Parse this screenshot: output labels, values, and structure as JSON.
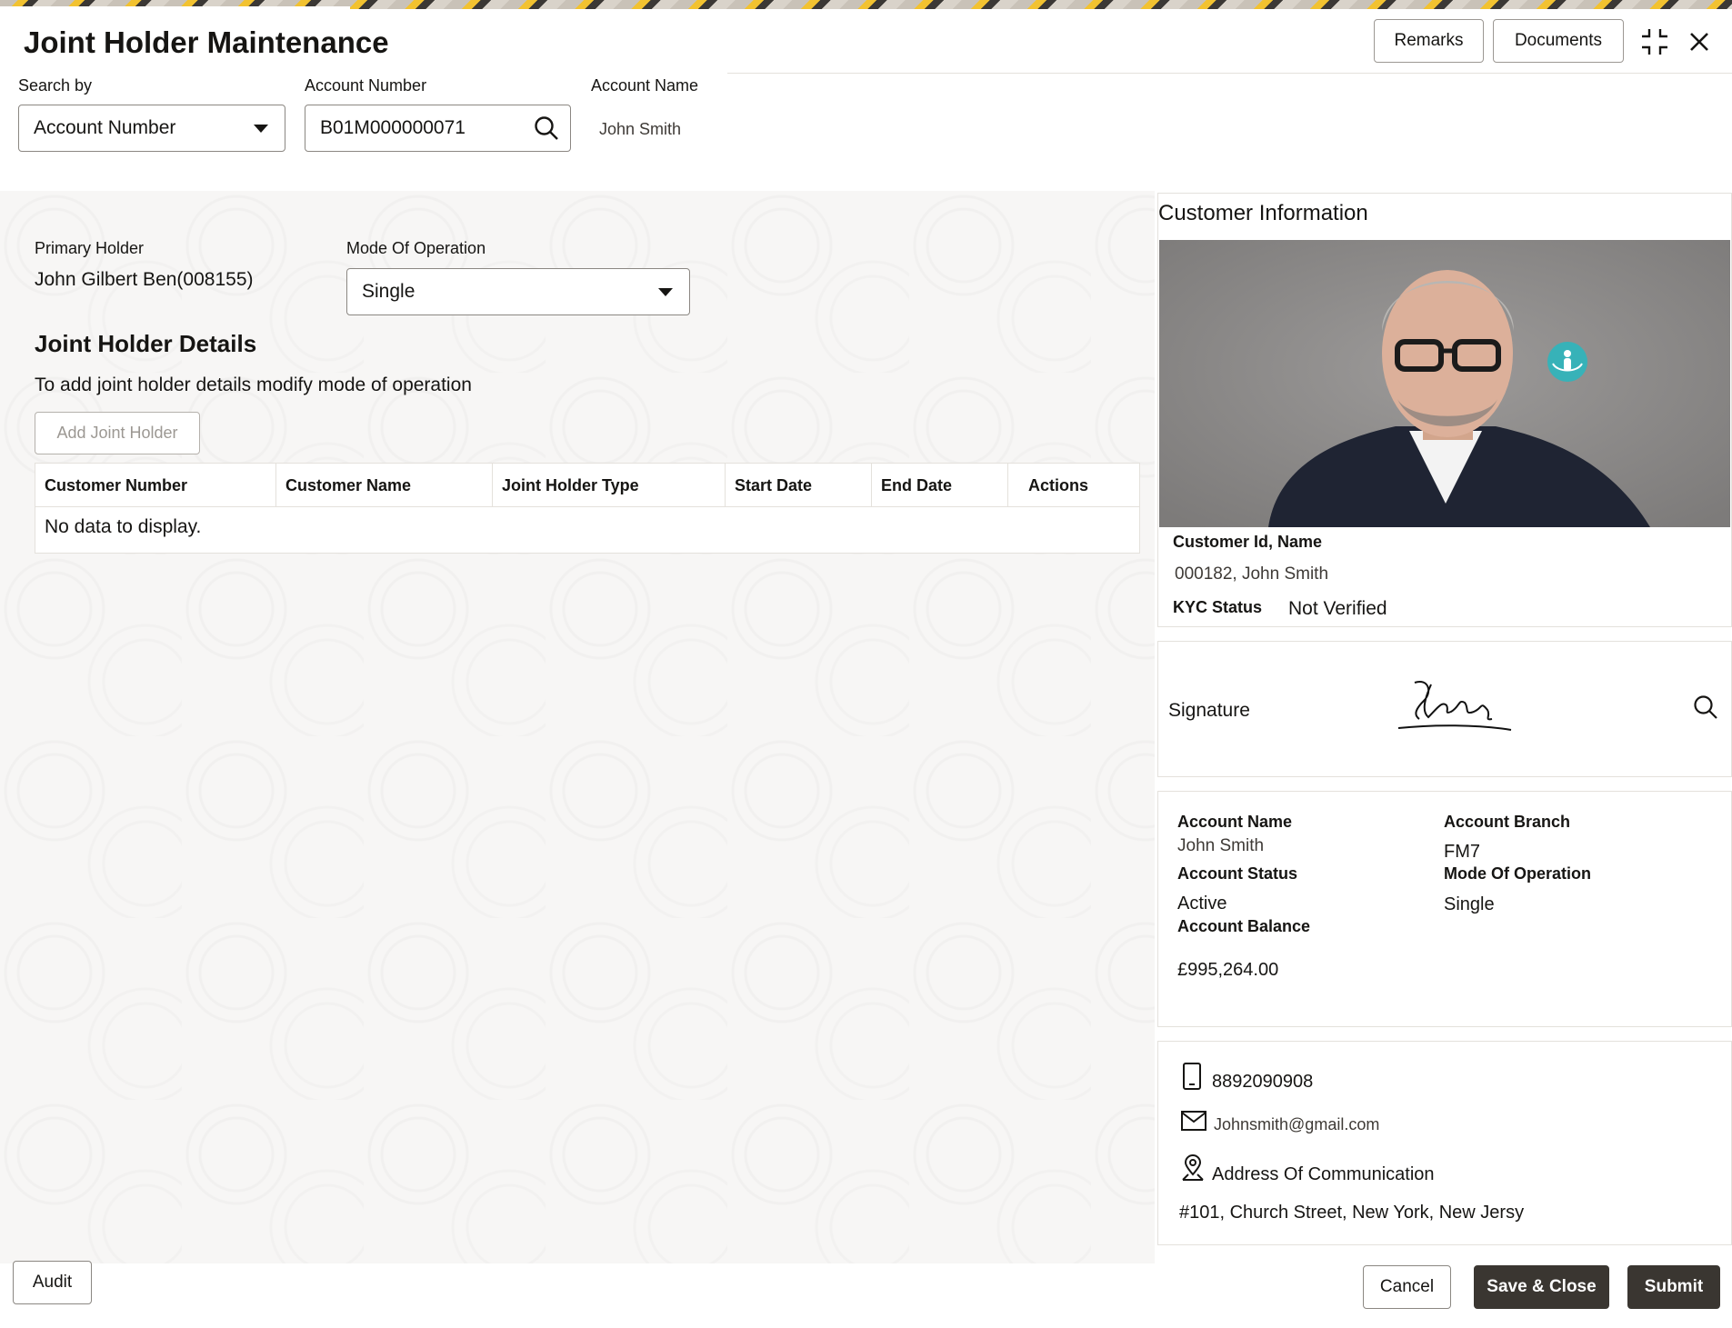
{
  "header": {
    "title": "Joint Holder Maintenance",
    "remarks_label": "Remarks",
    "documents_label": "Documents"
  },
  "search": {
    "search_by_label": "Search by",
    "search_by_value": "Account Number",
    "account_number_label": "Account Number",
    "account_number_value": "B01M000000071",
    "account_name_label": "Account Name",
    "account_name_value": "John Smith"
  },
  "main": {
    "primary_holder_label": "Primary Holder",
    "primary_holder_value": "John Gilbert Ben(008155)",
    "mode_label": "Mode Of Operation",
    "mode_value": "Single",
    "section_title": "Joint Holder Details",
    "hint": "To add joint holder details modify mode of operation",
    "add_button": "Add Joint Holder",
    "table": {
      "columns": [
        "Customer Number",
        "Customer Name",
        "Joint Holder Type",
        "Start Date",
        "End Date",
        "Actions"
      ],
      "empty_text": "No data to display."
    }
  },
  "customer": {
    "section_title": "Customer Information",
    "id_name_label": "Customer Id, Name",
    "id_name_value": "000182, John Smith",
    "kyc_label": "KYC Status",
    "kyc_value": "Not Verified",
    "signature_label": "Signature"
  },
  "account": {
    "name_label": "Account Name",
    "name_value": "John Smith",
    "branch_label": "Account Branch",
    "branch_value": "FM7",
    "status_label": "Account Status",
    "status_value": "Active",
    "mode_label": "Mode Of Operation",
    "mode_value": "Single",
    "balance_label": "Account Balance",
    "balance_value": "£995,264.00"
  },
  "contact": {
    "phone": "8892090908",
    "email": "Johnsmith@gmail.com",
    "address_label": "Address Of Communication",
    "address_value": "#101, Church Street, New York, New Jersy"
  },
  "footer": {
    "audit": "Audit",
    "cancel": "Cancel",
    "save_close": "Save & Close",
    "submit": "Submit"
  }
}
